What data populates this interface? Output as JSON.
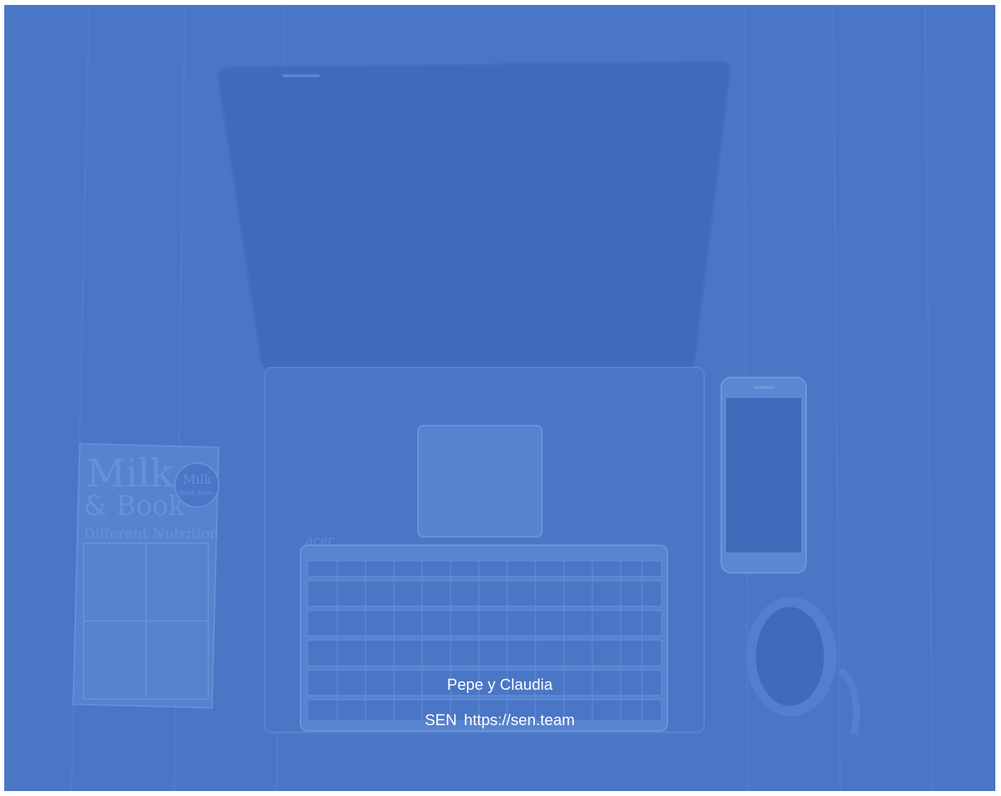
{
  "caption": {
    "names": "Pepe y Claudia",
    "org": "SEN",
    "url": "https://sen.team"
  },
  "photo": {
    "book_title_line1": "Milk",
    "book_title_line2": "& Book",
    "book_subtitle": "Different Nutrition",
    "book_badge_line1": "Milk",
    "book_badge_line2": "Book Store",
    "laptop_brand": "acer"
  },
  "colors": {
    "overlay": "#4a76c6",
    "text": "#ffffff"
  }
}
